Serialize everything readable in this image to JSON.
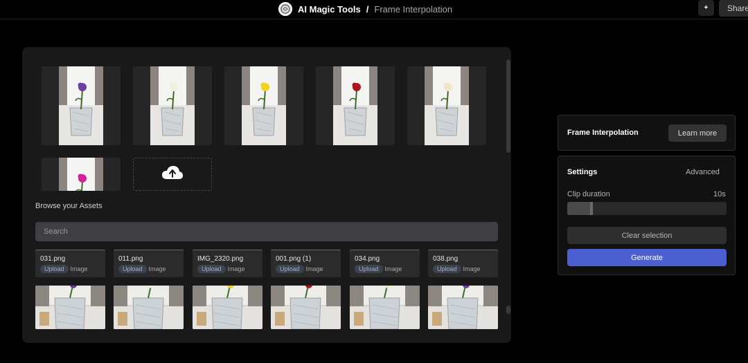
{
  "header": {
    "app_name": "AI Magic Tools",
    "separator": "/",
    "page_title": "Frame Interpolation",
    "share_label": "Share",
    "sparkle_icon": "sparkle-icon"
  },
  "frames": {
    "items": [
      {
        "flower_color": "#6b3fa0"
      },
      {
        "flower_color": "#f0f0e0"
      },
      {
        "flower_color": "#f2d21a"
      },
      {
        "flower_color": "#b0141c"
      },
      {
        "flower_color": "#f3e6c8"
      },
      {
        "flower_color": "#d4209a"
      }
    ],
    "upload_icon": "cloud-upload-icon"
  },
  "assets": {
    "browse_label": "Browse your Assets",
    "search_placeholder": "Search",
    "items": [
      {
        "name": "031.png",
        "tag": "Upload",
        "type": "Image"
      },
      {
        "name": "011.png",
        "tag": "Upload",
        "type": "Image"
      },
      {
        "name": "IMG_2320.png",
        "tag": "Upload",
        "type": "Image"
      },
      {
        "name": "001.png (1)",
        "tag": "Upload",
        "type": "Image"
      },
      {
        "name": "034.png",
        "tag": "Upload",
        "type": "Image"
      },
      {
        "name": "038.png",
        "tag": "Upload",
        "type": "Image"
      }
    ]
  },
  "info_panel": {
    "title": "Frame Interpolation",
    "learn_more_label": "Learn more"
  },
  "settings": {
    "title": "Settings",
    "advanced_label": "Advanced",
    "clip_duration_label": "Clip duration",
    "clip_duration_value": "10s",
    "clip_duration_fraction": 0.15,
    "clear_label": "Clear selection",
    "generate_label": "Generate",
    "accent_color": "#4c5fd0"
  }
}
